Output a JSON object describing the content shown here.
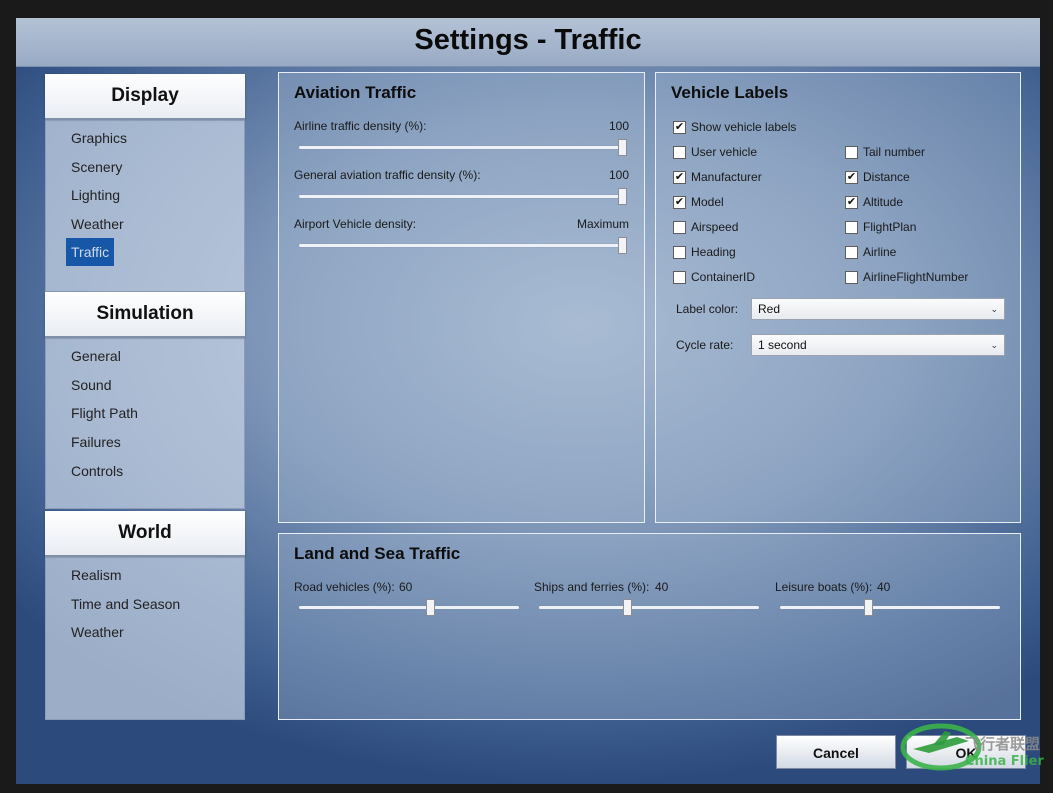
{
  "window": {
    "title": "Settings - Traffic"
  },
  "nav": {
    "groups": [
      {
        "title": "Display",
        "items": [
          "Graphics",
          "Scenery",
          "Lighting",
          "Weather",
          "Traffic"
        ],
        "selected": "Traffic"
      },
      {
        "title": "Simulation",
        "items": [
          "General",
          "Sound",
          "Flight Path",
          "Failures",
          "Controls"
        ]
      },
      {
        "title": "World",
        "items": [
          "Realism",
          "Time and Season",
          "Weather"
        ]
      }
    ]
  },
  "aviation": {
    "title": "Aviation Traffic",
    "sliders": [
      {
        "label": "Airline traffic density (%):",
        "value": "100",
        "level": 1.0
      },
      {
        "label": "General aviation traffic density (%):",
        "value": "100",
        "level": 1.0
      },
      {
        "label": "Airport Vehicle density:",
        "value": "Maximum",
        "level": 1.0
      }
    ]
  },
  "labels": {
    "title": "Vehicle Labels",
    "show": {
      "label": "Show vehicle labels",
      "checked": true
    },
    "left": [
      {
        "label": "User vehicle",
        "checked": false
      },
      {
        "label": "Manufacturer",
        "checked": true
      },
      {
        "label": "Model",
        "checked": true
      },
      {
        "label": "Airspeed",
        "checked": false
      },
      {
        "label": "Heading",
        "checked": false
      },
      {
        "label": "ContainerID",
        "checked": false
      }
    ],
    "right": [
      {
        "label": "Tail number",
        "checked": false
      },
      {
        "label": "Distance",
        "checked": true
      },
      {
        "label": "Altitude",
        "checked": true
      },
      {
        "label": "FlightPlan",
        "checked": false
      },
      {
        "label": "Airline",
        "checked": false
      },
      {
        "label": "AirlineFlightNumber",
        "checked": false
      }
    ],
    "label_color": {
      "label": "Label color:",
      "value": "Red"
    },
    "cycle_rate": {
      "label": "Cycle rate:",
      "value": "1 second"
    }
  },
  "landsea": {
    "title": "Land and Sea Traffic",
    "sliders": [
      {
        "label": "Road vehicles (%):",
        "value": "60",
        "level": 0.6
      },
      {
        "label": "Ships and ferries (%):",
        "value": "40",
        "level": 0.4
      },
      {
        "label": "Leisure boats (%):",
        "value": "40",
        "level": 0.4
      }
    ]
  },
  "buttons": {
    "cancel": "Cancel",
    "ok": "OK"
  },
  "watermark": {
    "text_cn": "飞行者联盟",
    "text_en": "China Flier"
  }
}
